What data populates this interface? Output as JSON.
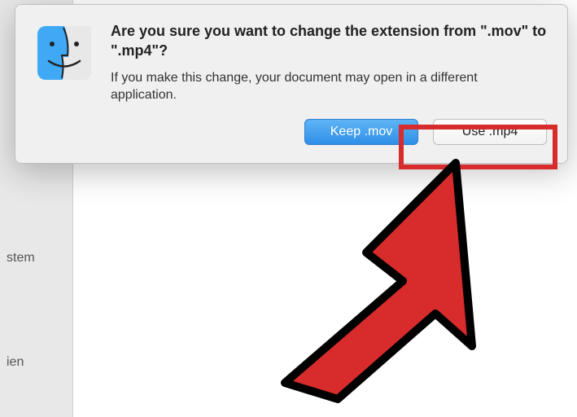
{
  "dialog": {
    "heading": "Are you sure you want to change the extension from \".mov\" to \".mp4\"?",
    "body": "If you make this change, your document may open in a different application.",
    "buttons": {
      "keep": "Keep .mov",
      "use": "Use .mp4"
    }
  },
  "sidebar": {
    "items": [
      "",
      "stem",
      "",
      "ien"
    ]
  },
  "icon": {
    "finder_bg_left": "#3fa9f5",
    "finder_bg_right": "#e8e8e8"
  }
}
